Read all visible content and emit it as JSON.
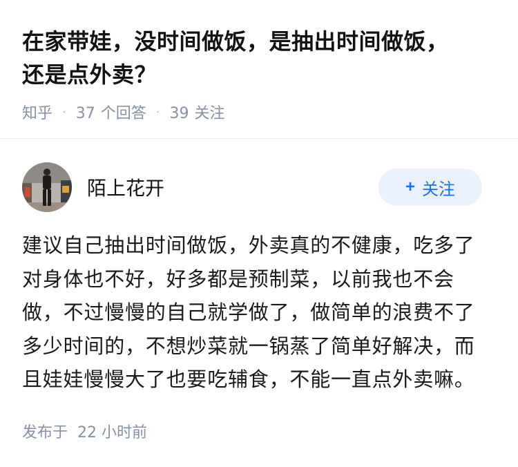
{
  "question": {
    "title_line1": "在家带娃，没时间做饭，是抽出时间做饭，",
    "title_line2": "还是点外卖？",
    "source": "知乎",
    "separator": "·",
    "answer_count": "37",
    "answer_count_label": "个回答",
    "follow_count": "39",
    "follow_count_label": "关注"
  },
  "author": {
    "name": "陌上花开",
    "follow_plus": "+",
    "follow_label": "关注"
  },
  "answer": {
    "lines": [
      "建议自己抽出时间做饭，外卖真的不健康，吃多了",
      "对身体也不好，好多都是预制菜，以前我也不会",
      "做，不过慢慢的自己就学做了，做简单的浪费不了",
      "多少时间的，不想炒菜就一锅蒸了简单好解决，而",
      "且娃娃慢慢大了也要吃辅食，不能一直点外卖嘛。"
    ]
  },
  "footer": {
    "posted_label": "发布于",
    "posted_time": "22 小时前"
  },
  "colors": {
    "text_primary": "#121212",
    "text_meta": "#8590a6",
    "accent_blue": "#1772f6",
    "button_bg": "#e8f1fc"
  }
}
